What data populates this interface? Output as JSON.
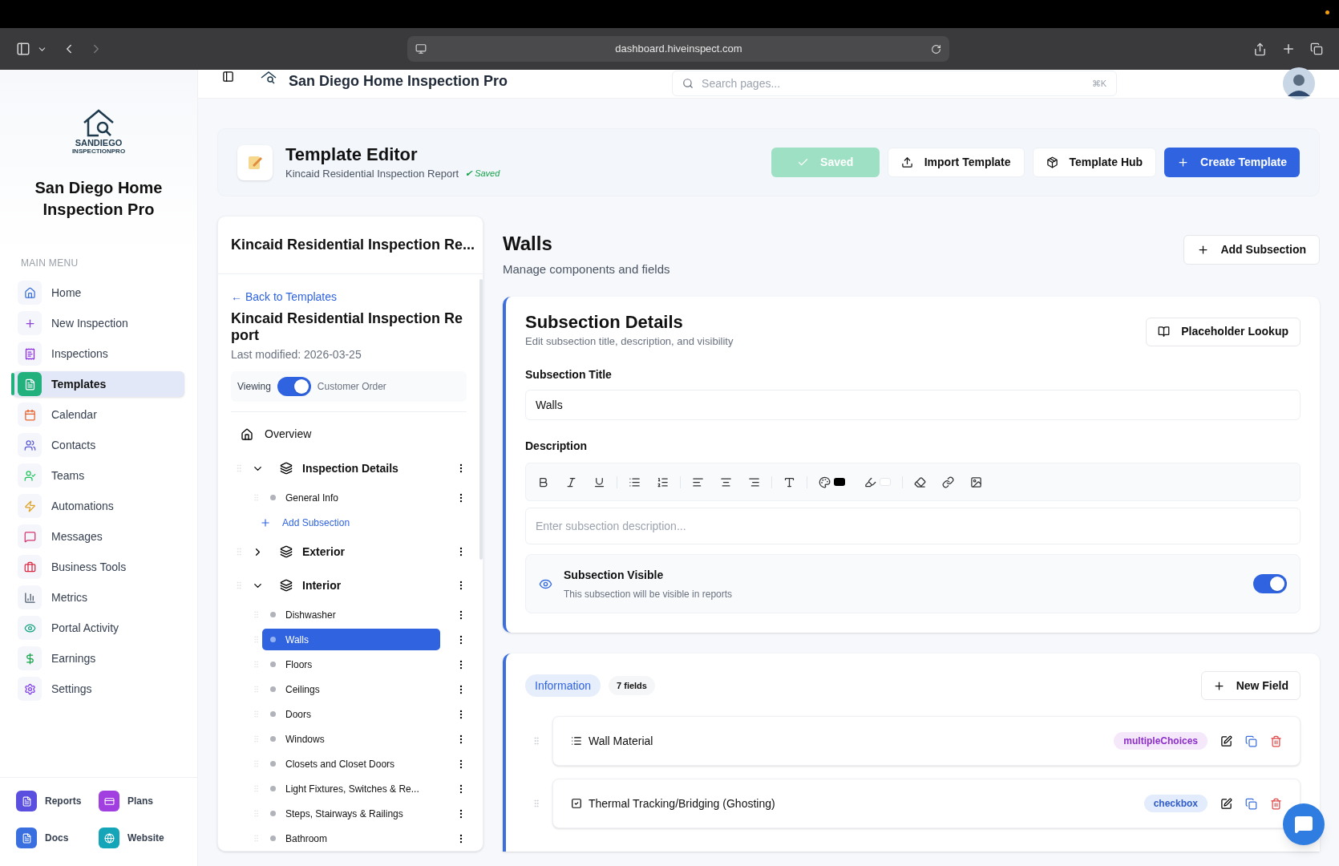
{
  "browser": {
    "url": "dashboard.hiveinspect.com"
  },
  "app_header": {
    "title": "San Diego Home Inspection Pro",
    "search_placeholder": "Search pages...",
    "shortcut": "⌘K"
  },
  "sidebar": {
    "brand": "San Diego Home Inspection Pro",
    "logo_lines": [
      "SANDIEGO",
      "INSPECTIONPRO"
    ],
    "section_label": "MAIN MENU",
    "items": [
      {
        "label": "Home",
        "selected": false
      },
      {
        "label": "New Inspection",
        "selected": false
      },
      {
        "label": "Inspections",
        "selected": false
      },
      {
        "label": "Templates",
        "selected": true
      },
      {
        "label": "Calendar",
        "selected": false
      },
      {
        "label": "Contacts",
        "selected": false
      },
      {
        "label": "Teams",
        "selected": false
      },
      {
        "label": "Automations",
        "selected": false
      },
      {
        "label": "Messages",
        "selected": false
      },
      {
        "label": "Business Tools",
        "selected": false
      },
      {
        "label": "Metrics",
        "selected": false
      },
      {
        "label": "Portal Activity",
        "selected": false
      },
      {
        "label": "Earnings",
        "selected": false
      },
      {
        "label": "Settings",
        "selected": false
      }
    ],
    "footer_links": [
      {
        "label": "Reports",
        "color": "#5b4fe0"
      },
      {
        "label": "Plans",
        "color": "#a23fe0"
      },
      {
        "label": "Docs",
        "color": "#3a6fe0"
      },
      {
        "label": "Website",
        "color": "#14a6b8"
      }
    ]
  },
  "editor_header": {
    "title": "Template Editor",
    "subtitle": "Kincaid Residential Inspection Report",
    "saved_note": "✔ Saved",
    "buttons": [
      {
        "label": "Saved",
        "kind": "saved"
      },
      {
        "label": "Import Template",
        "kind": "import"
      },
      {
        "label": "Template Hub",
        "kind": "hub"
      },
      {
        "label": "Create Template",
        "kind": "create"
      }
    ]
  },
  "tree": {
    "panel_title": "Kincaid Residential Inspection Re...",
    "back_link": "← Back to Templates",
    "template_name": "Kincaid Residential Inspection Report",
    "last_modified": "Last modified: 2026-03-25",
    "toggle": {
      "left_label": "Viewing",
      "right_label": "Customer Order",
      "on": true
    },
    "overview": "Overview",
    "sections": [
      {
        "title": "Inspection Details",
        "expanded": true,
        "add_label": "Add Subsection",
        "children": [
          {
            "label": "General Info",
            "selected": false
          }
        ]
      },
      {
        "title": "Exterior",
        "expanded": false
      },
      {
        "title": "Interior",
        "expanded": true,
        "children": [
          {
            "label": "Dishwasher",
            "selected": false
          },
          {
            "label": "Walls",
            "selected": true
          },
          {
            "label": "Floors",
            "selected": false
          },
          {
            "label": "Ceilings",
            "selected": false
          },
          {
            "label": "Doors",
            "selected": false
          },
          {
            "label": "Windows",
            "selected": false
          },
          {
            "label": "Closets and Closet Doors",
            "selected": false
          },
          {
            "label": "Light Fixtures, Switches & Re...",
            "selected": false
          },
          {
            "label": "Steps, Stairways & Railings",
            "selected": false
          },
          {
            "label": "Bathroom",
            "selected": false
          }
        ]
      }
    ]
  },
  "main": {
    "title": "Walls",
    "subtitle": "Manage components and fields",
    "add_button": "Add Subsection",
    "details": {
      "title": "Subsection Details",
      "subtitle": "Edit subsection title, description, and visibility",
      "lookup_button": "Placeholder Lookup",
      "title_label": "Subsection Title",
      "title_value": "Walls",
      "description_label": "Description",
      "description_placeholder": "Enter subsection description...",
      "visibility": {
        "title": "Subsection Visible",
        "description": "This subsection will be visible in reports",
        "on": true
      }
    },
    "fields_card": {
      "tab": "Information",
      "count": "7 fields",
      "new_field_button": "New Field",
      "fields": [
        {
          "name": "Wall Material",
          "type": "multipleChoices",
          "kind": "choices"
        },
        {
          "name": "Thermal Tracking/Bridging (Ghosting)",
          "type": "checkbox",
          "kind": "checkbox"
        }
      ]
    }
  }
}
